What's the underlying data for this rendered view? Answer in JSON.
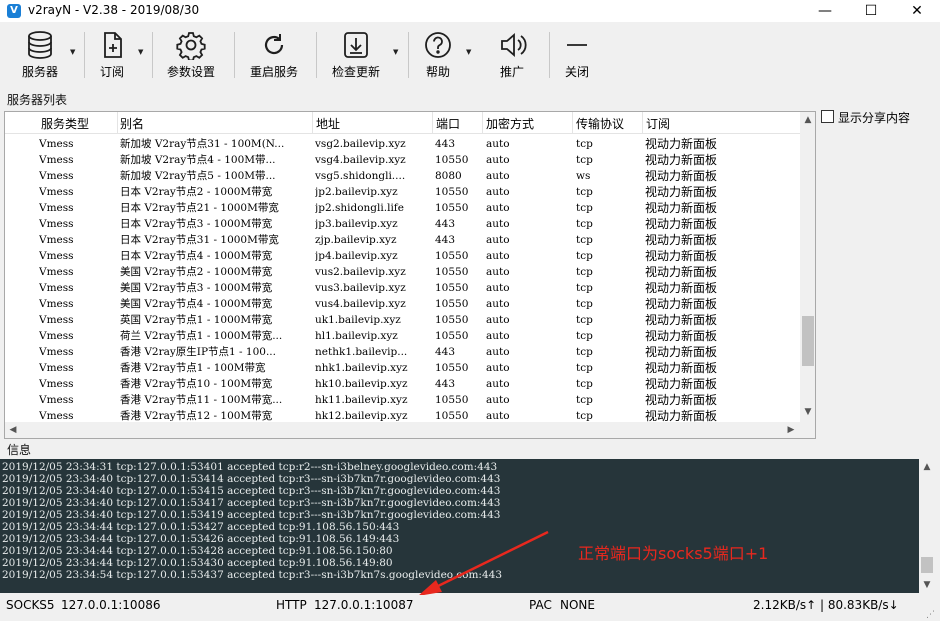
{
  "window": {
    "title": "v2rayN - V2.38 - 2019/08/30",
    "controls": {
      "minimize": "—",
      "maximize": "☐",
      "close": "✕"
    }
  },
  "toolbar": {
    "items": [
      {
        "label": "服务器",
        "icon": "database-icon",
        "has_dropdown": true
      },
      {
        "label": "订阅",
        "icon": "add-document-icon",
        "has_dropdown": true
      },
      {
        "label": "参数设置",
        "icon": "gear-icon",
        "has_dropdown": false
      },
      {
        "label": "重启服务",
        "icon": "restart-icon",
        "has_dropdown": false
      },
      {
        "label": "检查更新",
        "icon": "download-icon",
        "has_dropdown": true
      },
      {
        "label": "帮助",
        "icon": "help-icon",
        "has_dropdown": true
      },
      {
        "label": "推广",
        "icon": "speaker-icon",
        "has_dropdown": false
      },
      {
        "label": "关闭",
        "icon": "minus-icon",
        "has_dropdown": false
      }
    ]
  },
  "server_list": {
    "section_label": "服务器列表",
    "columns": [
      "服务类型",
      "别名",
      "地址",
      "端口",
      "加密方式",
      "传输协议",
      "订阅"
    ],
    "rows": [
      [
        "Vmess",
        "新加坡 V2ray节点31 - 100M(N...",
        "vsg2.bailevip.xyz",
        "443",
        "auto",
        "tcp",
        "视动力新面板"
      ],
      [
        "Vmess",
        "新加坡 V2ray节点4 - 100M带...",
        "vsg4.bailevip.xyz",
        "10550",
        "auto",
        "tcp",
        "视动力新面板"
      ],
      [
        "Vmess",
        "新加坡 V2ray节点5 - 100M带...",
        "vsg5.shidongli....",
        "8080",
        "auto",
        "ws",
        "视动力新面板"
      ],
      [
        "Vmess",
        "日本 V2ray节点2 - 1000M带宽",
        "jp2.bailevip.xyz",
        "10550",
        "auto",
        "tcp",
        "视动力新面板"
      ],
      [
        "Vmess",
        "日本 V2ray节点21 - 1000M带宽",
        "jp2.shidongli.life",
        "10550",
        "auto",
        "tcp",
        "视动力新面板"
      ],
      [
        "Vmess",
        "日本 V2ray节点3 - 1000M带宽",
        "jp3.bailevip.xyz",
        "443",
        "auto",
        "tcp",
        "视动力新面板"
      ],
      [
        "Vmess",
        "日本 V2ray节点31 - 1000M带宽",
        "zjp.bailevip.xyz",
        "443",
        "auto",
        "tcp",
        "视动力新面板"
      ],
      [
        "Vmess",
        "日本 V2ray节点4 - 1000M带宽",
        "jp4.bailevip.xyz",
        "10550",
        "auto",
        "tcp",
        "视动力新面板"
      ],
      [
        "Vmess",
        "美国 V2ray节点2 - 1000M带宽",
        "vus2.bailevip.xyz",
        "10550",
        "auto",
        "tcp",
        "视动力新面板"
      ],
      [
        "Vmess",
        "美国 V2ray节点3 - 1000M带宽",
        "vus3.bailevip.xyz",
        "10550",
        "auto",
        "tcp",
        "视动力新面板"
      ],
      [
        "Vmess",
        "美国 V2ray节点4 - 1000M带宽",
        "vus4.bailevip.xyz",
        "10550",
        "auto",
        "tcp",
        "视动力新面板"
      ],
      [
        "Vmess",
        "英国 V2ray节点1 - 1000M带宽",
        "uk1.bailevip.xyz",
        "10550",
        "auto",
        "tcp",
        "视动力新面板"
      ],
      [
        "Vmess",
        "荷兰 V2ray节点1 - 1000M带宽...",
        "hl1.bailevip.xyz",
        "10550",
        "auto",
        "tcp",
        "视动力新面板"
      ],
      [
        "Vmess",
        "香港 V2ray原生IP节点1 - 100...",
        "nethk1.bailevip...",
        "443",
        "auto",
        "tcp",
        "视动力新面板"
      ],
      [
        "Vmess",
        "香港 V2ray节点1 - 100M带宽",
        "nhk1.bailevip.xyz",
        "10550",
        "auto",
        "tcp",
        "视动力新面板"
      ],
      [
        "Vmess",
        "香港 V2ray节点10 - 100M带宽",
        "hk10.bailevip.xyz",
        "443",
        "auto",
        "tcp",
        "视动力新面板"
      ],
      [
        "Vmess",
        "香港 V2ray节点11 - 100M带宽...",
        "hk11.bailevip.xyz",
        "10550",
        "auto",
        "tcp",
        "视动力新面板"
      ],
      [
        "Vmess",
        "香港 V2ray节点12 - 100M带宽",
        "hk12.bailevip.xyz",
        "10550",
        "auto",
        "tcp",
        "视动力新面板"
      ]
    ]
  },
  "share": {
    "label": "显示分享内容",
    "checked": false
  },
  "info": {
    "section_label": "信息",
    "lines": [
      "2019/12/05 23:34:31 tcp:127.0.0.1:53401 accepted tcp:r2---sn-i3belney.googlevideo.com:443",
      "2019/12/05 23:34:40 tcp:127.0.0.1:53414 accepted tcp:r3---sn-i3b7kn7r.googlevideo.com:443",
      "2019/12/05 23:34:40 tcp:127.0.0.1:53415 accepted tcp:r3---sn-i3b7kn7r.googlevideo.com:443",
      "2019/12/05 23:34:40 tcp:127.0.0.1:53417 accepted tcp:r3---sn-i3b7kn7r.googlevideo.com:443",
      "2019/12/05 23:34:40 tcp:127.0.0.1:53419 accepted tcp:r3---sn-i3b7kn7r.googlevideo.com:443",
      "2019/12/05 23:34:44 tcp:127.0.0.1:53427 accepted tcp:91.108.56.150:443",
      "2019/12/05 23:34:44 tcp:127.0.0.1:53426 accepted tcp:91.108.56.149:443",
      "2019/12/05 23:34:44 tcp:127.0.0.1:53428 accepted tcp:91.108.56.150:80",
      "2019/12/05 23:34:44 tcp:127.0.0.1:53430 accepted tcp:91.108.56.149:80",
      "2019/12/05 23:34:54 tcp:127.0.0.1:53437 accepted tcp:r3---sn-i3b7kn7s.googlevideo.com:443"
    ]
  },
  "annotation": {
    "text": "正常端口为socks5端口+1",
    "color": "#e8281e"
  },
  "status": {
    "socks_label": "SOCKS5",
    "socks_value": "127.0.0.1:10086",
    "http_label": "HTTP",
    "http_value": "127.0.0.1:10087",
    "pac_label": "PAC",
    "pac_value": "NONE",
    "speed": "2.12KB/s↑ | 80.83KB/s↓"
  },
  "colors": {
    "log_background": "#26353a",
    "log_text": "#e8ecec",
    "accent": "#1a7fd6"
  }
}
